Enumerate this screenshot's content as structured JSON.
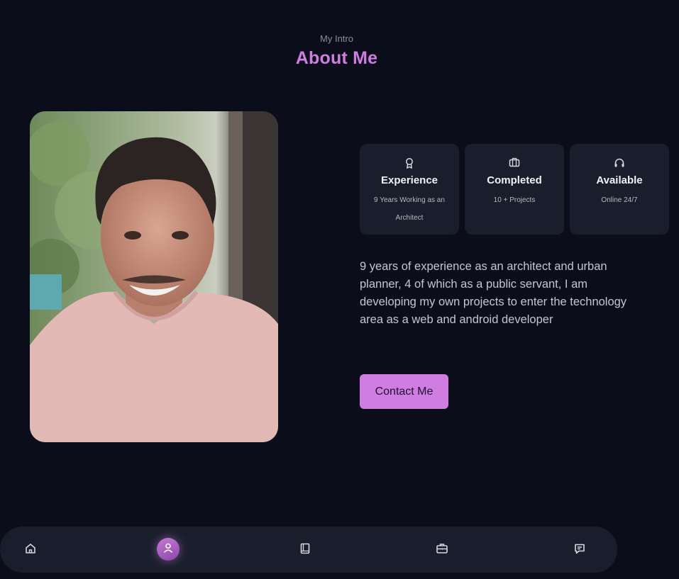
{
  "header": {
    "subtitle": "My Intro",
    "title": "About Me"
  },
  "profile_photo": {
    "alt": "Portrait of a smiling man with curly dark hair in a pink t-shirt"
  },
  "info_cards": [
    {
      "icon": "award-icon",
      "title": "Experience",
      "subtitle": "9 Years Working as an Architect"
    },
    {
      "icon": "briefcase-icon",
      "title": "Completed",
      "subtitle": "10 + Projects"
    },
    {
      "icon": "headphones-icon",
      "title": "Available",
      "subtitle": "Online 24/7"
    }
  ],
  "description": "9 years of experience as an architect and urban planner, 4 of which as a public servant, I am developing my own projects to enter the technology area as a web and android developer",
  "contact_button": {
    "label": "Contact Me"
  },
  "bottom_nav": {
    "items": [
      {
        "icon": "home-icon",
        "active": false
      },
      {
        "icon": "user-icon",
        "active": true
      },
      {
        "icon": "book-icon",
        "active": false
      },
      {
        "icon": "briefcase-icon",
        "active": false
      },
      {
        "icon": "message-icon",
        "active": false
      }
    ]
  },
  "colors": {
    "background": "#0b0e1a",
    "accent": "#d07ce0",
    "card": "#1a1e2c"
  }
}
